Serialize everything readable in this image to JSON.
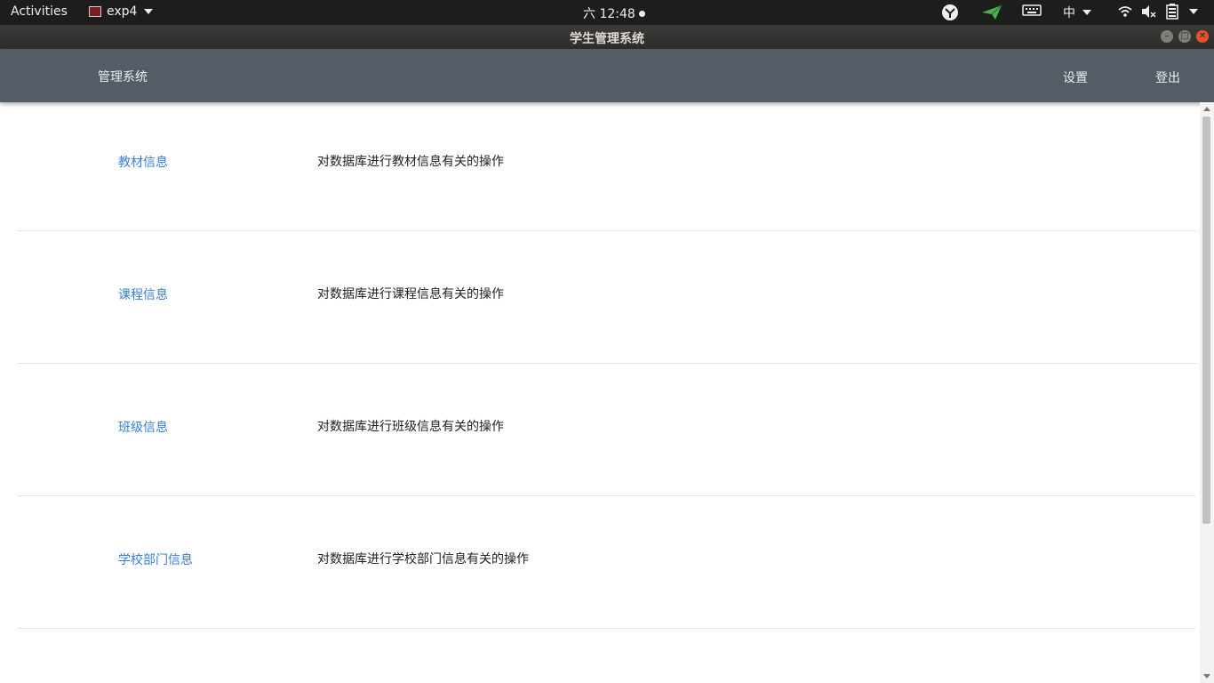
{
  "topbar": {
    "activities": "Activities",
    "app_name": "exp4",
    "clock": "六 12:48",
    "input_method": "中"
  },
  "window": {
    "title": "学生管理系统"
  },
  "navbar": {
    "brand": "管理系统",
    "settings": "设置",
    "logout": "登出"
  },
  "items": [
    {
      "link": "教材信息",
      "desc": "对数据库进行教材信息有关的操作"
    },
    {
      "link": "课程信息",
      "desc": "对数据库进行课程信息有关的操作"
    },
    {
      "link": "班级信息",
      "desc": "对数据库进行班级信息有关的操作"
    },
    {
      "link": "学校部门信息",
      "desc": "对数据库进行学校部门信息有关的操作"
    }
  ],
  "colors": {
    "navbar": "#545c66",
    "link": "#3a7ecf",
    "close_button": "#e6502a"
  }
}
